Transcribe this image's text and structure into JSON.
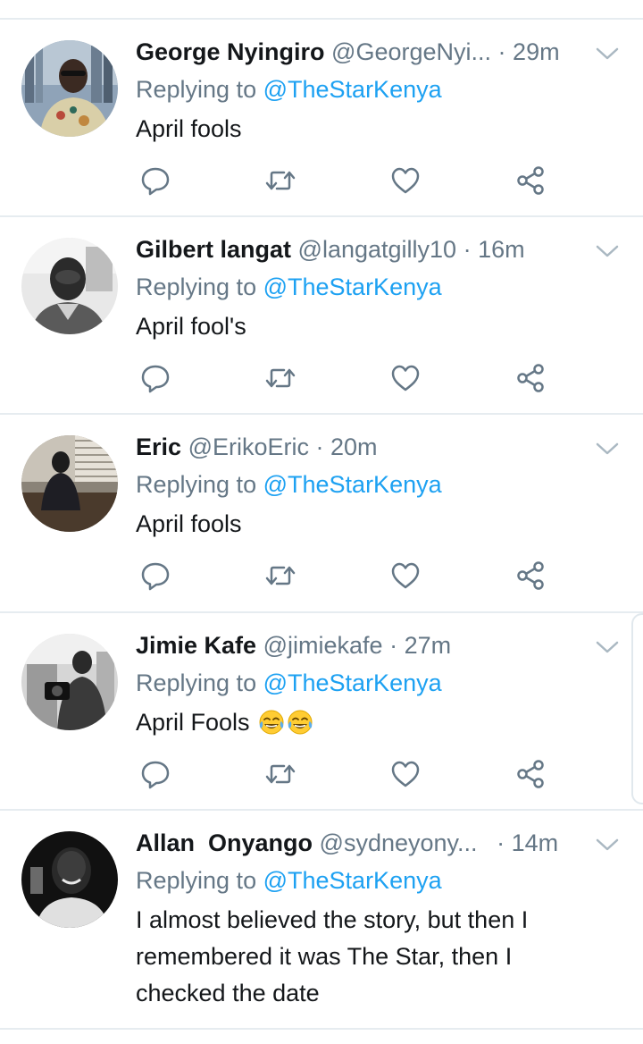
{
  "tweets": [
    {
      "name": "George Nyingiro",
      "handle": "@GeorgeNyi...",
      "time": "29m",
      "replying_prefix": "Replying to",
      "replying_to": "@TheStarKenya",
      "text": "April fools"
    },
    {
      "name": "Gilbert langat",
      "handle": "@langatgilly10",
      "time": "16m",
      "replying_prefix": "Replying to",
      "replying_to": "@TheStarKenya",
      "text": "April fool's"
    },
    {
      "name": "Eric",
      "handle": "@ErikoEric",
      "time": "20m",
      "replying_prefix": "Replying to",
      "replying_to": "@TheStarKenya",
      "text": "April fools"
    },
    {
      "name": "Jimie Kafe",
      "handle": "@jimiekafe",
      "time": "27m",
      "replying_prefix": "Replying to",
      "replying_to": "@TheStarKenya",
      "text": "April Fools",
      "emojis": [
        "face-with-tears-of-joy",
        "face-with-tears-of-joy"
      ]
    },
    {
      "name": "Allan  Onyango",
      "handle": "@sydneyony...",
      "time": "14m",
      "replying_prefix": "Replying to",
      "replying_to": "@TheStarKenya",
      "text": "I almost believed the story, but then I remembered it was The Star, then I checked the date"
    }
  ],
  "icons": {
    "reply": "reply-icon",
    "retweet": "retweet-icon",
    "like": "like-icon",
    "share": "share-icon",
    "caret": "chevron-down-icon"
  },
  "colors": {
    "name": "#14171a",
    "muted": "#657786",
    "link": "#1da1f2",
    "divider": "#e6ecf0"
  }
}
